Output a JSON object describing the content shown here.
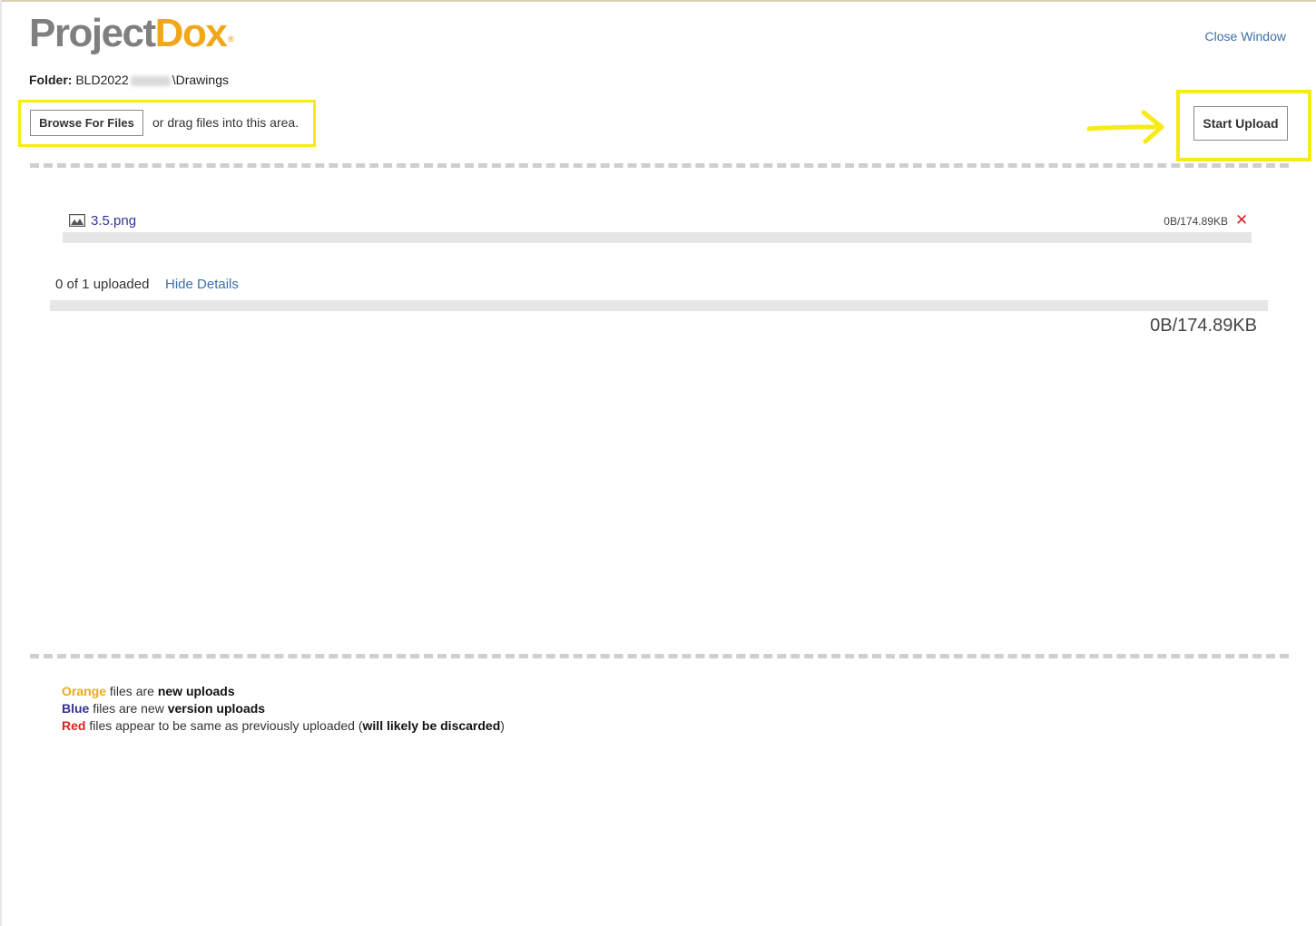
{
  "header": {
    "logo_part1": "Project",
    "logo_part2": "Dox",
    "logo_reg": "®",
    "close_window": "Close Window"
  },
  "folder": {
    "label": "Folder:",
    "prefix": "BLD2022",
    "suffix": "\\Drawings"
  },
  "upload": {
    "browse_label": "Browse For Files",
    "drag_text": "or drag files into this area.",
    "start_label": "Start Upload"
  },
  "files": [
    {
      "name": "3.5.png",
      "size": "0B/174.89KB",
      "progress": 0,
      "remove_glyph": "✕",
      "icon": "image-file-icon"
    }
  ],
  "summary": {
    "status": "0 of 1 uploaded",
    "hide_details": "Hide Details",
    "total_size": "0B/174.89KB",
    "progress": 0
  },
  "legend": {
    "orange_word": "Orange",
    "orange_mid": " files are ",
    "orange_strong": "new uploads",
    "blue_word": "Blue",
    "blue_mid": " files are new ",
    "blue_strong": "version uploads",
    "red_word": "Red",
    "red_mid": " files appear to be same as previously uploaded (",
    "red_strong": "will likely be discarded",
    "red_end": ")"
  },
  "colors": {
    "accent_orange": "#f2a71b",
    "link_blue": "#3d6fa8",
    "file_blue": "#333399",
    "red": "#e02020",
    "highlight_yellow": "#f6eb16"
  }
}
